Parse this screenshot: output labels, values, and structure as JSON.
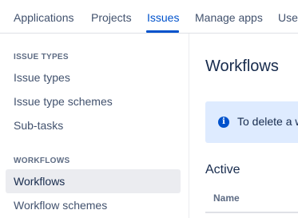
{
  "topnav": {
    "tabs": [
      {
        "label": "Applications"
      },
      {
        "label": "Projects"
      },
      {
        "label": "Issues"
      },
      {
        "label": "Manage apps"
      },
      {
        "label": "User"
      }
    ],
    "active_tab": "Issues"
  },
  "sidebar": {
    "sections": [
      {
        "title": "ISSUE TYPES",
        "items": [
          {
            "label": "Issue types"
          },
          {
            "label": "Issue type schemes"
          },
          {
            "label": "Sub-tasks"
          }
        ]
      },
      {
        "title": "WORKFLOWS",
        "items": [
          {
            "label": "Workflows"
          },
          {
            "label": "Workflow schemes"
          }
        ]
      }
    ],
    "selected_item": "Workflows"
  },
  "main": {
    "title": "Workflows",
    "info_banner": {
      "icon": "info-icon",
      "icon_glyph": "i",
      "text": "To delete a w"
    },
    "section_heading": "Active",
    "table": {
      "columns": [
        {
          "label": "Name"
        }
      ]
    }
  },
  "colors": {
    "accent": "#0052cc",
    "text": "#172b4d",
    "muted": "#42526e",
    "selected_bg": "#ebecf0",
    "info_bg": "#deebff"
  }
}
